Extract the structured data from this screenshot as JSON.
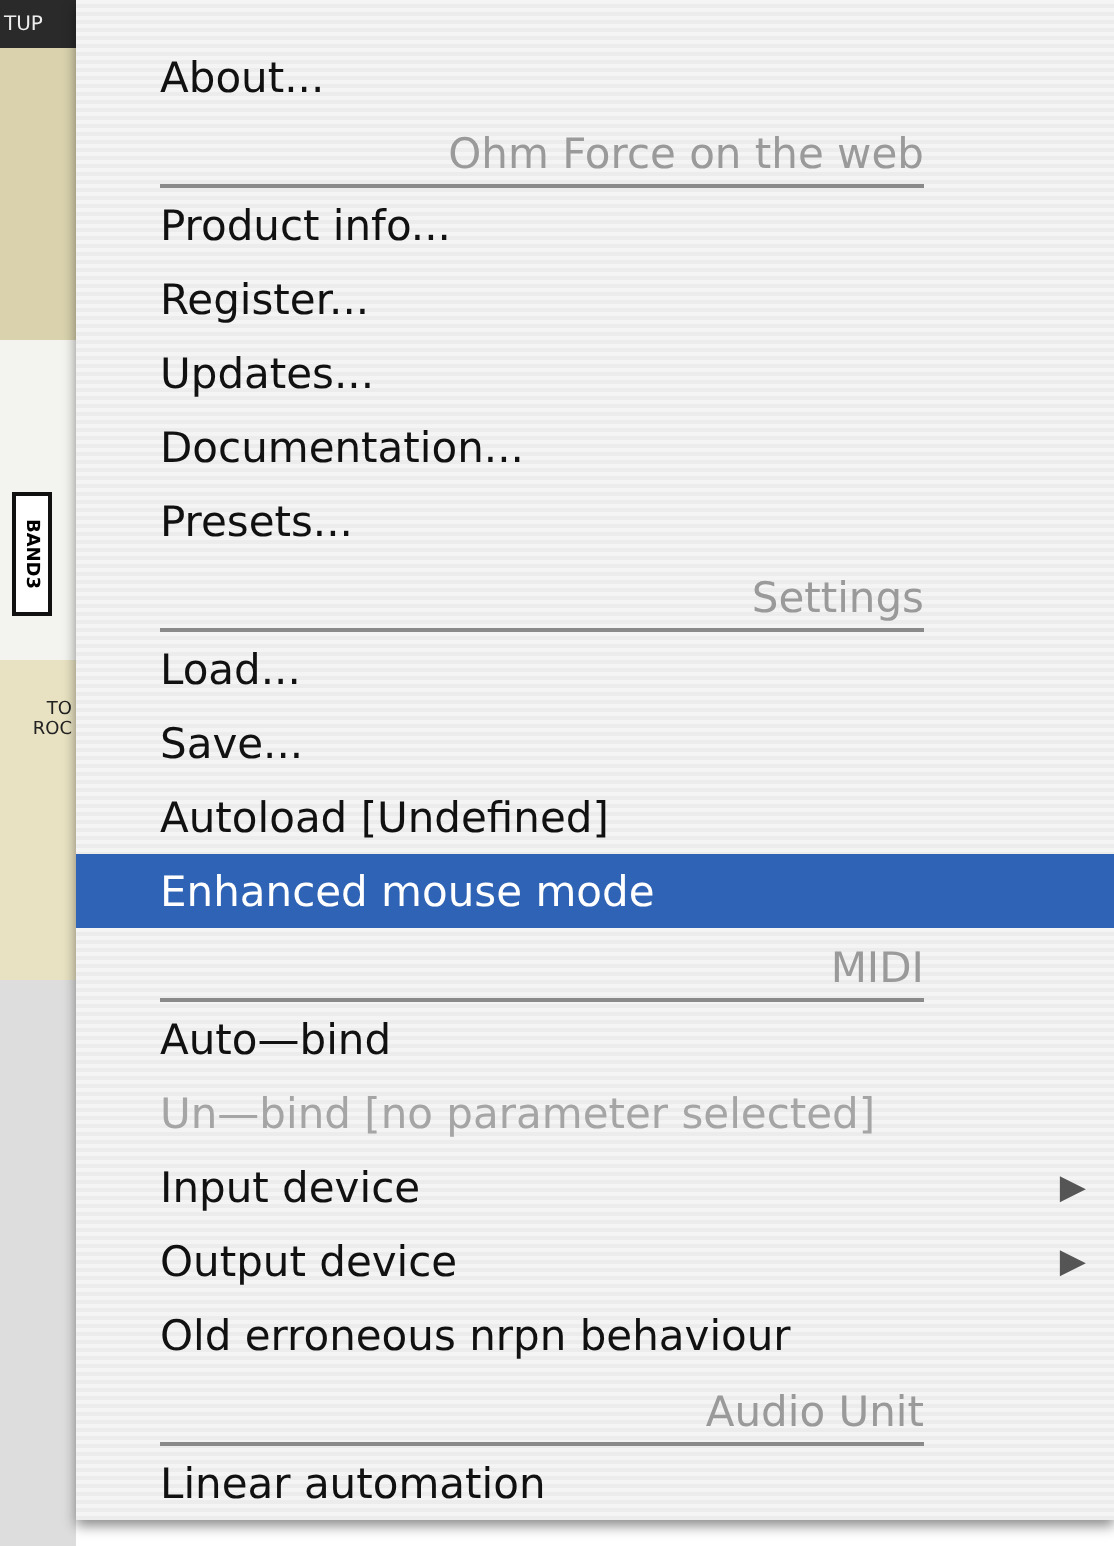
{
  "background_app": {
    "labels": [
      {
        "text": "TUP",
        "kind": "header"
      },
      {
        "text": "BAND3",
        "kind": "vertical"
      },
      {
        "text": "TO",
        "kind": "plain"
      },
      {
        "text": "ROC",
        "kind": "plain"
      }
    ]
  },
  "menu": {
    "items": [
      {
        "kind": "item",
        "label": "About...",
        "selected": false,
        "disabled": false
      },
      {
        "kind": "header",
        "label": "Ohm Force on the web"
      },
      {
        "kind": "item",
        "label": "Product info...",
        "selected": false,
        "disabled": false
      },
      {
        "kind": "item",
        "label": "Register...",
        "selected": false,
        "disabled": false
      },
      {
        "kind": "item",
        "label": "Updates...",
        "selected": false,
        "disabled": false
      },
      {
        "kind": "item",
        "label": "Documentation...",
        "selected": false,
        "disabled": false
      },
      {
        "kind": "item",
        "label": "Presets...",
        "selected": false,
        "disabled": false
      },
      {
        "kind": "header",
        "label": "Settings"
      },
      {
        "kind": "item",
        "label": "Load...",
        "selected": false,
        "disabled": false
      },
      {
        "kind": "item",
        "label": "Save...",
        "selected": false,
        "disabled": false
      },
      {
        "kind": "item",
        "label": "Autoload [Undefined]",
        "selected": false,
        "disabled": false
      },
      {
        "kind": "item",
        "label": "Enhanced mouse mode",
        "selected": true,
        "disabled": false
      },
      {
        "kind": "header",
        "label": "MIDI"
      },
      {
        "kind": "item",
        "label": "Auto—bind",
        "selected": false,
        "disabled": false
      },
      {
        "kind": "item",
        "label": "Un—bind [no parameter selected]",
        "selected": false,
        "disabled": true
      },
      {
        "kind": "item",
        "label": "Input device",
        "selected": false,
        "disabled": false,
        "arrow": "▶"
      },
      {
        "kind": "item",
        "label": "Output device",
        "selected": false,
        "disabled": false,
        "arrow": "▶"
      },
      {
        "kind": "item",
        "label": "Old erroneous nrpn behaviour",
        "selected": false,
        "disabled": false
      },
      {
        "kind": "header",
        "label": "Audio Unit"
      },
      {
        "kind": "item",
        "label": "Linear automation",
        "selected": false,
        "disabled": false
      }
    ]
  }
}
